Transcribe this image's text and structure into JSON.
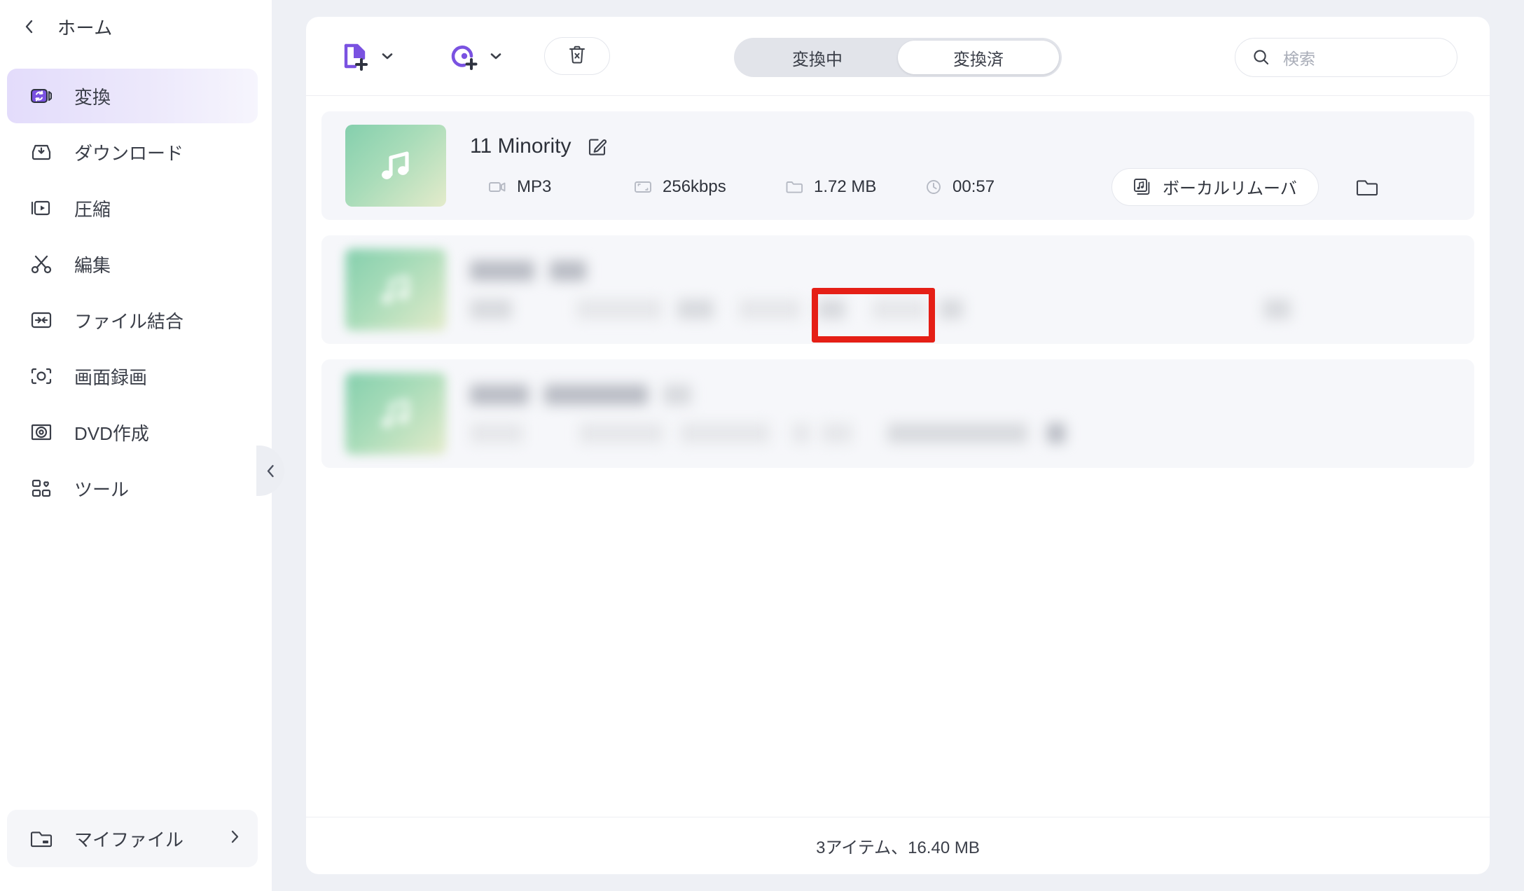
{
  "sidebar": {
    "back_icon": "chevron-left-icon",
    "home_label": "ホーム",
    "items": [
      {
        "label": "変換",
        "icon": "convert-video-icon",
        "active": true
      },
      {
        "label": "ダウンロード",
        "icon": "download-tray-icon",
        "active": false
      },
      {
        "label": "圧縮",
        "icon": "compress-video-icon",
        "active": false
      },
      {
        "label": "編集",
        "icon": "scissors-icon",
        "active": false
      },
      {
        "label": "ファイル結合",
        "icon": "merge-files-icon",
        "active": false
      },
      {
        "label": "画面録画",
        "icon": "screen-record-icon",
        "active": false
      },
      {
        "label": "DVD作成",
        "icon": "dvd-disc-icon",
        "active": false
      },
      {
        "label": "ツール",
        "icon": "toolbox-grid-icon",
        "active": false
      }
    ],
    "myfiles": {
      "label": "マイファイル",
      "icon": "folder-icon",
      "chevron": "chevron-right-icon"
    },
    "collapse": {
      "icon": "chevron-left-icon"
    }
  },
  "toolbar": {
    "add_file": {
      "icon": "add-file-icon",
      "caret": "chevron-down-icon"
    },
    "add_disc": {
      "icon": "add-disc-icon",
      "caret": "chevron-down-icon"
    },
    "delete": {
      "icon": "trash-x-icon"
    },
    "tabs": [
      {
        "label": "変換中",
        "selected": false
      },
      {
        "label": "変換済",
        "selected": true
      }
    ],
    "search": {
      "icon": "search-icon",
      "placeholder": "検索",
      "value": ""
    }
  },
  "list": {
    "rows": [
      {
        "selected": true,
        "thumbnail_icon": "music-note-icon",
        "title": "11 Minority",
        "edit_icon": "edit-pencil-icon",
        "format": {
          "icon": "video-camera-icon",
          "value": "MP3"
        },
        "bitrate": {
          "icon": "resolution-icon",
          "value": "256kbps"
        },
        "size": {
          "icon": "folder-icon",
          "value": "1.72 MB"
        },
        "duration": {
          "icon": "clock-icon",
          "value": "00:57"
        },
        "action": {
          "icon": "vocal-remover-icon",
          "label": "ボーカルリムーバ"
        },
        "open_folder_icon": "folder-open-icon"
      },
      {
        "selected": false,
        "blurred": true,
        "thumbnail_icon": "music-note-icon"
      },
      {
        "selected": false,
        "blurred": true,
        "thumbnail_icon": "music-note-icon"
      }
    ]
  },
  "highlight": {
    "color": "#e51f16",
    "target": "MP3"
  },
  "footer": {
    "status": "3アイテム、16.40 MB"
  },
  "colors": {
    "accent": "#7a52e1",
    "active_nav_bg": "#e3dcfb",
    "panel_bg": "#eef0f5",
    "row_bg": "#f6f7fa",
    "highlight": "#e51f16",
    "thumb_from": "#84cfad",
    "thumb_to": "#e4ebcb"
  }
}
